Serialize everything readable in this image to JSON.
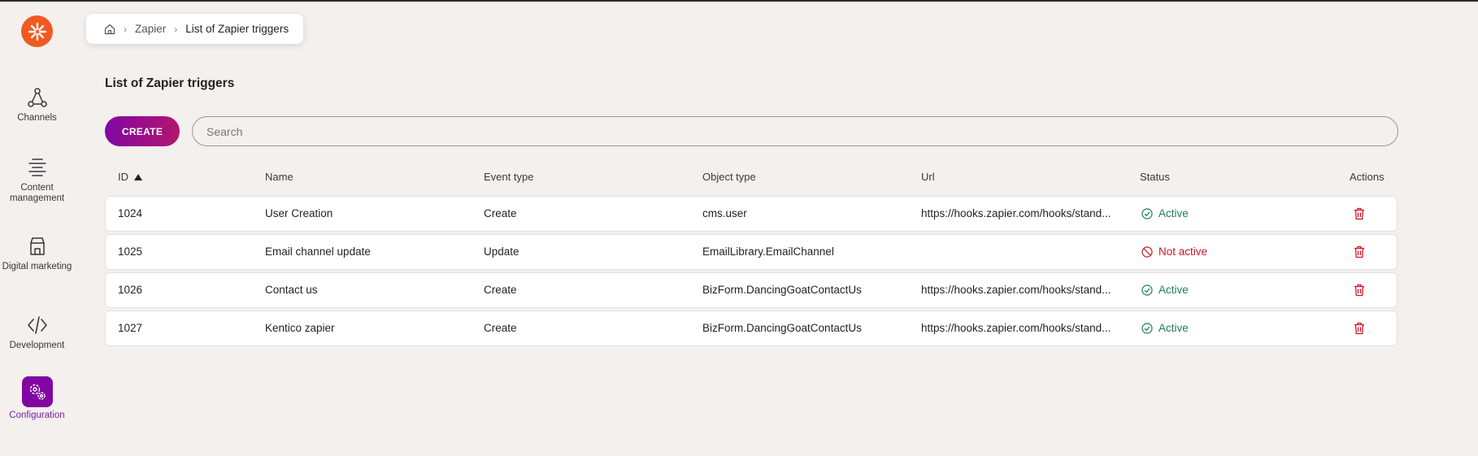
{
  "breadcrumb": {
    "home_icon": "home-icon",
    "items": [
      "Zapier",
      "List of Zapier triggers"
    ]
  },
  "sidebar": {
    "items": [
      {
        "label": "Channels",
        "icon": "channels-icon"
      },
      {
        "label": "Content management",
        "icon": "content-management-icon"
      },
      {
        "label": "Digital marketing",
        "icon": "digital-marketing-icon"
      },
      {
        "label": "Development",
        "icon": "development-icon"
      },
      {
        "label": "Configuration",
        "icon": "configuration-icon",
        "active": true
      }
    ]
  },
  "page": {
    "title": "List of Zapier triggers"
  },
  "toolbar": {
    "create_label": "CREATE",
    "search_placeholder": "Search",
    "search_value": ""
  },
  "table": {
    "columns": [
      "ID",
      "Name",
      "Event type",
      "Object type",
      "Url",
      "Status",
      "Actions"
    ],
    "sort": {
      "column": "ID",
      "direction": "ascending"
    },
    "rows": [
      {
        "id": "1024",
        "name": "User Creation",
        "event": "Create",
        "object": "cms.user",
        "url": "https://hooks.zapier.com/hooks/stand...",
        "status": "Active"
      },
      {
        "id": "1025",
        "name": "Email channel update",
        "event": "Update",
        "object": "EmailLibrary.EmailChannel",
        "url": "",
        "status": "Not active"
      },
      {
        "id": "1026",
        "name": "Contact us",
        "event": "Create",
        "object": "BizForm.DancingGoatContactUs",
        "url": "https://hooks.zapier.com/hooks/stand...",
        "status": "Active"
      },
      {
        "id": "1027",
        "name": "Kentico zapier",
        "event": "Create",
        "object": "BizForm.DancingGoatContactUs",
        "url": "https://hooks.zapier.com/hooks/stand...",
        "status": "Active"
      }
    ]
  },
  "colors": {
    "accent": "#8107a3",
    "brand_orange": "#f05a22",
    "active_green": "#1c7c5c",
    "inactive_red": "#d0152a"
  }
}
